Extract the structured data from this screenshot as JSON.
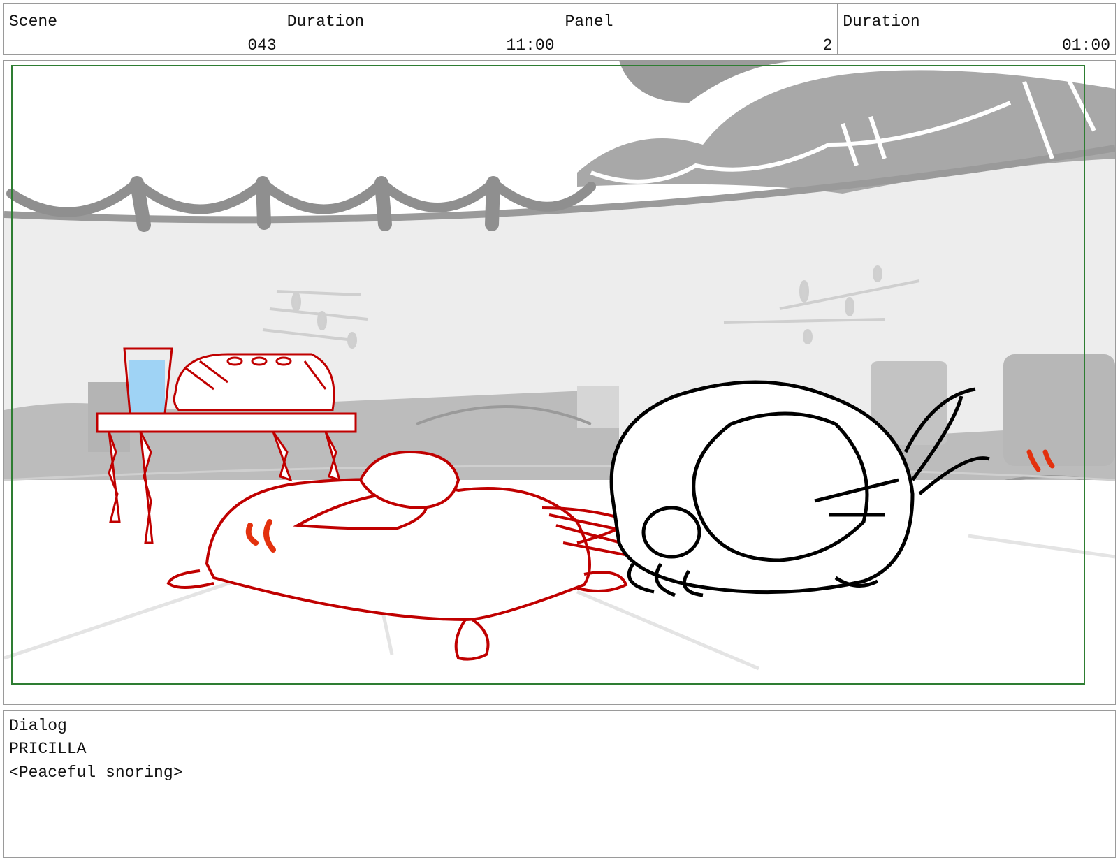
{
  "header": {
    "scene_label": "Scene",
    "scene_value": "043",
    "scene_duration_label": "Duration",
    "scene_duration_value": "11:00",
    "panel_label": "Panel",
    "panel_value": "2",
    "panel_duration_label": "Duration",
    "panel_duration_value": "01:00"
  },
  "frame": {
    "safe_frame_color": "#2e7d32",
    "sketch_red": "#c00000",
    "sketch_black": "#000000",
    "water_blue": "#9fd3f5"
  },
  "dialog": {
    "label": "Dialog",
    "character": "PRICILLA",
    "line": "<Peaceful snoring>"
  }
}
